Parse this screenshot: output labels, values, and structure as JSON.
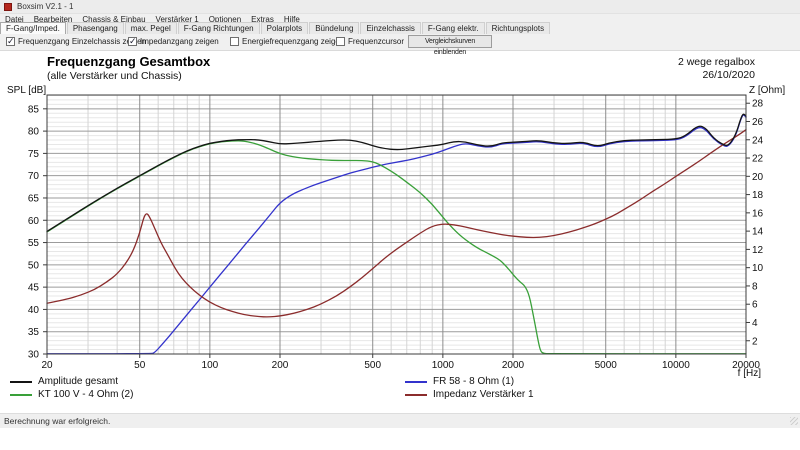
{
  "window": {
    "title": "Boxsim V2.1 - 1",
    "status": "Berechnung war erfolgreich."
  },
  "menu": {
    "items": [
      "Datei",
      "Bearbeiten",
      "Chassis & Einbau",
      "Verstärker 1",
      "Optionen",
      "Extras",
      "Hilfe"
    ]
  },
  "tabs": {
    "active": "F-Gang/Imped.",
    "items": [
      "F-Gang/Imped.",
      "Phasengang",
      "max. Pegel",
      "F-Gang Richtungen",
      "Polarplots",
      "Bündelung",
      "Einzelchassis",
      "F-Gang elektr.",
      "Richtungsplots"
    ]
  },
  "toolbar": {
    "checkboxes": [
      {
        "label": "Frequenzgang Einzelchassis zeigen",
        "checked": true
      },
      {
        "label": "Impedanzgang zeigen",
        "checked": true
      },
      {
        "label": "Energiefrequenzgang zeigen",
        "checked": false
      },
      {
        "label": "Frequenzcursor",
        "checked": false
      }
    ],
    "compare_button": "Vergleichskurven einblenden"
  },
  "chart_header": {
    "title": "Frequenzgang Gesamtbox",
    "subtitle": "(alle Verstärker und Chassis)",
    "project": "2 wege regalbox",
    "date": "26/10/2020"
  },
  "chart_data": {
    "type": "line",
    "x_axis": {
      "label": "f [Hz]",
      "scale": "log",
      "min": 20,
      "max": 20000,
      "ticks": [
        20,
        50,
        100,
        200,
        500,
        1000,
        2000,
        5000,
        10000,
        20000
      ],
      "minor": [
        30,
        40,
        60,
        70,
        80,
        90,
        300,
        400,
        600,
        700,
        800,
        900,
        3000,
        4000,
        6000,
        7000,
        8000,
        9000
      ]
    },
    "y_axis_left": {
      "label": "SPL [dB]",
      "min": 30,
      "max": 88.1,
      "ticks": [
        30,
        35,
        40,
        45,
        50,
        55,
        60,
        65,
        70,
        75,
        80,
        85
      ],
      "minor_step": 1
    },
    "y_axis_right": {
      "label": "Z [Ohm]",
      "min": 0.55,
      "max": 28.9,
      "ticks": [
        2,
        4,
        6,
        8,
        10,
        12,
        14,
        16,
        18,
        20,
        22,
        24,
        26,
        28
      ]
    },
    "grid": true,
    "legend_position": "bottom",
    "series": [
      {
        "name": "Amplitude gesamt",
        "color": "#141414",
        "axis": "left",
        "points": [
          [
            20,
            57.5
          ],
          [
            25,
            60.7
          ],
          [
            32,
            64.2
          ],
          [
            40,
            67.2
          ],
          [
            50,
            70.0
          ],
          [
            63,
            72.9
          ],
          [
            71,
            74.3
          ],
          [
            80,
            75.6
          ],
          [
            90,
            76.6
          ],
          [
            100,
            77.3
          ],
          [
            112,
            77.7
          ],
          [
            125,
            78.0
          ],
          [
            140,
            78.1
          ],
          [
            160,
            78.1
          ],
          [
            180,
            77.6
          ],
          [
            200,
            77.1
          ],
          [
            225,
            77.2
          ],
          [
            250,
            77.4
          ],
          [
            280,
            77.6
          ],
          [
            315,
            77.8
          ],
          [
            355,
            78.0
          ],
          [
            400,
            78.0
          ],
          [
            450,
            77.5
          ],
          [
            500,
            76.7
          ],
          [
            560,
            76.1
          ],
          [
            630,
            75.8
          ],
          [
            710,
            76.0
          ],
          [
            800,
            76.4
          ],
          [
            900,
            76.7
          ],
          [
            1000,
            77.0
          ],
          [
            1120,
            77.7
          ],
          [
            1250,
            77.6
          ],
          [
            1400,
            76.9
          ],
          [
            1600,
            76.5
          ],
          [
            1800,
            77.4
          ],
          [
            2000,
            77.5
          ],
          [
            2300,
            77.7
          ],
          [
            2600,
            77.9
          ],
          [
            3000,
            77.3
          ],
          [
            3500,
            77.2
          ],
          [
            4000,
            77.6
          ],
          [
            4600,
            76.5
          ],
          [
            5200,
            77.4
          ],
          [
            6000,
            77.9
          ],
          [
            7000,
            78.0
          ],
          [
            8500,
            78.1
          ],
          [
            10000,
            78.2
          ],
          [
            11000,
            78.9
          ],
          [
            12500,
            81.4
          ],
          [
            13500,
            80.6
          ],
          [
            14500,
            78.4
          ],
          [
            16000,
            76.9
          ],
          [
            16800,
            76.7
          ],
          [
            18000,
            78.9
          ],
          [
            19000,
            82.9
          ],
          [
            19500,
            84.0
          ],
          [
            20000,
            83.3
          ]
        ]
      },
      {
        "name": "FR 58 - 8 Ohm (1)",
        "color": "#3333cc",
        "axis": "left",
        "points": [
          [
            20,
            30.05
          ],
          [
            56,
            30.05
          ],
          [
            58,
            30.3
          ],
          [
            63,
            32.4
          ],
          [
            71,
            35.6
          ],
          [
            80,
            38.9
          ],
          [
            90,
            42.1
          ],
          [
            100,
            45.0
          ],
          [
            112,
            48.1
          ],
          [
            126,
            51.3
          ],
          [
            142,
            54.6
          ],
          [
            160,
            57.8
          ],
          [
            180,
            61.0
          ],
          [
            200,
            64.0
          ],
          [
            225,
            65.8
          ],
          [
            250,
            66.9
          ],
          [
            280,
            67.9
          ],
          [
            315,
            68.8
          ],
          [
            355,
            69.7
          ],
          [
            400,
            70.6
          ],
          [
            450,
            71.3
          ],
          [
            500,
            71.9
          ],
          [
            560,
            72.5
          ],
          [
            630,
            73.0
          ],
          [
            710,
            73.5
          ],
          [
            800,
            74.1
          ],
          [
            900,
            74.8
          ],
          [
            1000,
            75.6
          ],
          [
            1120,
            76.6
          ],
          [
            1250,
            77.3
          ],
          [
            1400,
            76.7
          ],
          [
            1600,
            76.3
          ],
          [
            1800,
            77.2
          ],
          [
            2000,
            77.3
          ],
          [
            2300,
            77.5
          ],
          [
            2600,
            77.7
          ],
          [
            3000,
            77.1
          ],
          [
            3500,
            77.0
          ],
          [
            4000,
            77.4
          ],
          [
            4600,
            76.3
          ],
          [
            5200,
            77.2
          ],
          [
            6000,
            77.7
          ],
          [
            7000,
            77.8
          ],
          [
            8500,
            77.9
          ],
          [
            10000,
            78.0
          ],
          [
            11000,
            78.7
          ],
          [
            12500,
            81.1
          ],
          [
            13500,
            80.3
          ],
          [
            14500,
            78.2
          ],
          [
            16000,
            76.7
          ],
          [
            16800,
            76.5
          ],
          [
            18000,
            78.7
          ],
          [
            19000,
            82.7
          ],
          [
            19500,
            83.8
          ],
          [
            20000,
            83.1
          ]
        ]
      },
      {
        "name": "KT 100 V - 4 Ohm (2)",
        "color": "#39a039",
        "axis": "left",
        "points": [
          [
            20,
            57.4
          ],
          [
            25,
            60.6
          ],
          [
            32,
            64.1
          ],
          [
            40,
            67.1
          ],
          [
            50,
            69.9
          ],
          [
            63,
            72.8
          ],
          [
            71,
            74.2
          ],
          [
            80,
            75.5
          ],
          [
            90,
            76.5
          ],
          [
            100,
            77.2
          ],
          [
            112,
            77.6
          ],
          [
            125,
            77.8
          ],
          [
            140,
            77.8
          ],
          [
            160,
            77.1
          ],
          [
            180,
            76.0
          ],
          [
            200,
            74.9
          ],
          [
            225,
            74.3
          ],
          [
            250,
            73.9
          ],
          [
            280,
            73.7
          ],
          [
            315,
            73.5
          ],
          [
            355,
            73.4
          ],
          [
            400,
            73.4
          ],
          [
            450,
            73.4
          ],
          [
            500,
            73.2
          ],
          [
            560,
            72.0
          ],
          [
            630,
            70.3
          ],
          [
            710,
            68.3
          ],
          [
            800,
            66.2
          ],
          [
            900,
            63.6
          ],
          [
            1000,
            60.7
          ],
          [
            1075,
            58.8
          ],
          [
            1200,
            56.3
          ],
          [
            1400,
            53.8
          ],
          [
            1600,
            52.3
          ],
          [
            1760,
            51.1
          ],
          [
            1900,
            49.3
          ],
          [
            2030,
            47.4
          ],
          [
            2150,
            46.1
          ],
          [
            2250,
            45.3
          ],
          [
            2350,
            43.2
          ],
          [
            2450,
            38.5
          ],
          [
            2550,
            33.5
          ],
          [
            2620,
            30.7
          ],
          [
            2700,
            30.1
          ],
          [
            3000,
            30.05
          ],
          [
            20000,
            30.05
          ]
        ]
      },
      {
        "name": "Impedanz Verstärker 1",
        "color": "#8b2c2c",
        "axis": "right",
        "points": [
          [
            20,
            6.1
          ],
          [
            24,
            6.5
          ],
          [
            28,
            7.0
          ],
          [
            32,
            7.6
          ],
          [
            36,
            8.4
          ],
          [
            40,
            9.3
          ],
          [
            44,
            10.6
          ],
          [
            47,
            11.9
          ],
          [
            50,
            13.8
          ],
          [
            52,
            15.5
          ],
          [
            53.5,
            16.0
          ],
          [
            55,
            15.6
          ],
          [
            58,
            14.3
          ],
          [
            62,
            12.6
          ],
          [
            66,
            11.4
          ],
          [
            71,
            9.9
          ],
          [
            76,
            8.8
          ],
          [
            82,
            7.9
          ],
          [
            90,
            7.0
          ],
          [
            100,
            6.2
          ],
          [
            112,
            5.6
          ],
          [
            125,
            5.2
          ],
          [
            140,
            4.85
          ],
          [
            160,
            4.65
          ],
          [
            180,
            4.6
          ],
          [
            200,
            4.7
          ],
          [
            230,
            5.0
          ],
          [
            260,
            5.4
          ],
          [
            300,
            6.0
          ],
          [
            350,
            6.9
          ],
          [
            400,
            7.9
          ],
          [
            450,
            8.9
          ],
          [
            500,
            9.9
          ],
          [
            560,
            11.0
          ],
          [
            630,
            12.0
          ],
          [
            710,
            12.9
          ],
          [
            800,
            13.8
          ],
          [
            900,
            14.55
          ],
          [
            1000,
            14.8
          ],
          [
            1120,
            14.7
          ],
          [
            1250,
            14.45
          ],
          [
            1400,
            14.15
          ],
          [
            1600,
            13.85
          ],
          [
            1800,
            13.6
          ],
          [
            2000,
            13.45
          ],
          [
            2300,
            13.3
          ],
          [
            2600,
            13.3
          ],
          [
            3000,
            13.5
          ],
          [
            3500,
            13.9
          ],
          [
            4000,
            14.35
          ],
          [
            4500,
            14.8
          ],
          [
            5000,
            15.3
          ],
          [
            5600,
            15.9
          ],
          [
            6300,
            16.7
          ],
          [
            7100,
            17.5
          ],
          [
            8000,
            18.4
          ],
          [
            9000,
            19.2
          ],
          [
            10000,
            20.0
          ],
          [
            11200,
            20.8
          ],
          [
            12500,
            21.6
          ],
          [
            14000,
            22.5
          ],
          [
            16000,
            23.5
          ],
          [
            18000,
            24.3
          ],
          [
            20000,
            25.1
          ]
        ]
      }
    ]
  }
}
